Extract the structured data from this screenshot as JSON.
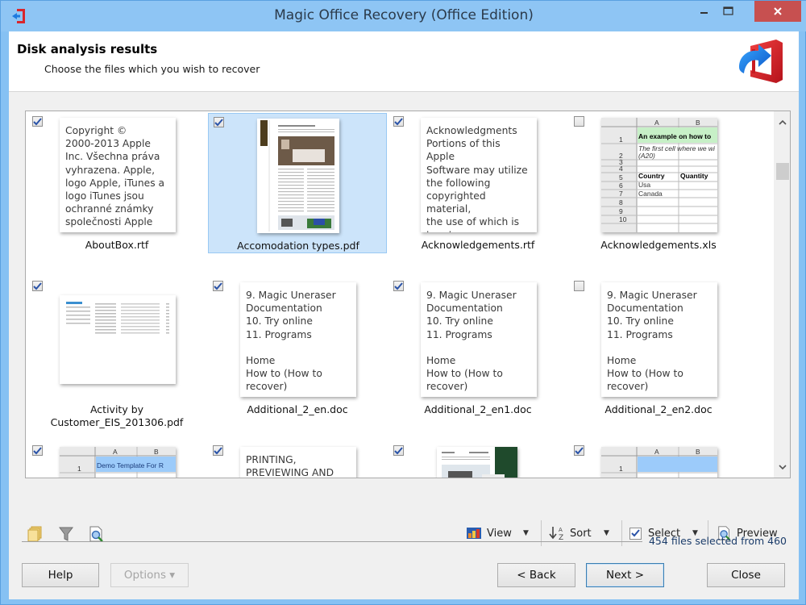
{
  "window": {
    "title": "Magic Office Recovery (Office Edition)",
    "controls": {
      "minimize": "minimize",
      "maximize": "maximize",
      "close": "close"
    }
  },
  "header": {
    "title": "Disk analysis results",
    "subtitle": "Choose the files which you wish to recover"
  },
  "files": [
    {
      "name": "AboutBox.rtf",
      "checked": true,
      "selected": false,
      "preview_type": "text",
      "preview_text": "Copyright ©\n2000-2013 Apple\nInc. Všechna práva\nvyhrazena. Apple,\nlogo Apple, iTunes a\nlogo iTunes jsou\nochranné známky\nspolečnosti Apple"
    },
    {
      "name": "Accomodation types.pdf",
      "checked": true,
      "selected": true,
      "preview_type": "pdf-photo"
    },
    {
      "name": "Acknowledgements.rtf",
      "checked": true,
      "selected": false,
      "preview_type": "text",
      "preview_text": "Acknowledgments\nPortions of this Apple\nSoftware may utilize\nthe following\ncopyrighted material,\nthe use of which is\nhereby\nacknowledged."
    },
    {
      "name": "Acknowledgements.xls",
      "checked": false,
      "selected": false,
      "preview_type": "spreadsheet",
      "sheet": {
        "cols": [
          "A",
          "B"
        ],
        "rows": [
          "1",
          "2",
          "3",
          "4",
          "5",
          "6",
          "7",
          "8",
          "9",
          "10"
        ],
        "r1": "An example on how to",
        "r2a": "The first cell where we wi",
        "r2b": "(A20)",
        "r4a": "Country",
        "r4b": "Quantity",
        "r5a": "Usa",
        "r6a": "Canada"
      }
    },
    {
      "name": "Activity by\nCustomer_EIS_201306.pdf",
      "checked": true,
      "selected": false,
      "preview_type": "pdf-table"
    },
    {
      "name": "Additional_2_en.doc",
      "checked": true,
      "selected": false,
      "preview_type": "text",
      "preview_text": "9. Magic Uneraser\nDocumentation\n10. Try online\n11. Programs\n\nHome\nHow to (How to\nrecover)"
    },
    {
      "name": "Additional_2_en1.doc",
      "checked": true,
      "selected": false,
      "preview_type": "text",
      "preview_text": "9. Magic Uneraser\nDocumentation\n10. Try online\n11. Programs\n\nHome\nHow to (How to\nrecover)"
    },
    {
      "name": "Additional_2_en2.doc",
      "checked": false,
      "selected": false,
      "preview_type": "text",
      "preview_text": "9. Magic Uneraser\nDocumentation\n10. Try online\n11. Programs\n\nHome\nHow to (How to\nrecover)"
    },
    {
      "name": "",
      "checked": true,
      "selected": false,
      "preview_type": "spreadsheet-demo",
      "sheet": {
        "cols": [
          "A",
          "B"
        ],
        "rows": [
          "1"
        ],
        "r1": "Demo Template For R"
      }
    },
    {
      "name": "",
      "checked": true,
      "selected": false,
      "preview_type": "text",
      "preview_text": "PRINTING,\nPREVIEWING AND"
    },
    {
      "name": "",
      "checked": true,
      "selected": false,
      "preview_type": "pdf-brochure"
    },
    {
      "name": "",
      "checked": true,
      "selected": false,
      "preview_type": "spreadsheet-blue",
      "sheet": {
        "cols": [
          "A",
          "B"
        ],
        "rows": [
          "1"
        ]
      }
    }
  ],
  "toolbar": {
    "left_icons": [
      "folders-icon",
      "filter-icon",
      "find-icon"
    ],
    "view_label": "View",
    "sort_label": "Sort",
    "select_label": "Select",
    "preview_label": "Preview"
  },
  "status": {
    "text": "454 files selected from 460",
    "selected": 454,
    "total": 460
  },
  "buttons": {
    "help": "Help",
    "options": "Options ▾",
    "back": "< Back",
    "next": "Next >",
    "close": "Close"
  },
  "colors": {
    "titlebar": "#8ec5f4",
    "close_button": "#c75050",
    "selection": "#cce4fa",
    "status_text": "#1b3c6a",
    "brand_red": "#d9262c",
    "brand_blue": "#1e7be0"
  }
}
